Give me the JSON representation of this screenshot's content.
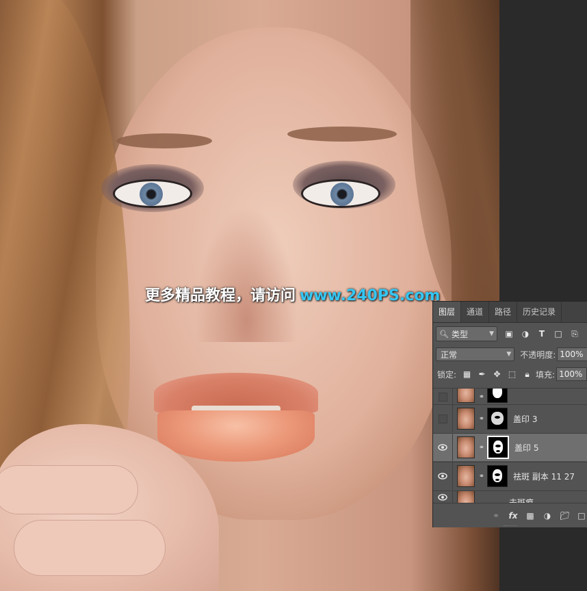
{
  "watermark": {
    "chinese": "更多精品教程，请访问",
    "url": "www.240PS.com"
  },
  "colors": {
    "panel_bg": "#535353",
    "tab_bar_bg": "#424242",
    "selected_layer_bg": "#6f6f6f",
    "watermark_url": "#35c6f2",
    "app_background": "#2b2b2b"
  },
  "panel": {
    "tabs": [
      {
        "label": "图层",
        "active": true
      },
      {
        "label": "通道",
        "active": false
      },
      {
        "label": "路径",
        "active": false
      },
      {
        "label": "历史记录",
        "active": false
      }
    ],
    "filter": {
      "kind_label": "类型",
      "icons": [
        "image-filter-icon",
        "adjustment-filter-icon",
        "type-filter-icon",
        "shape-filter-icon",
        "smart-object-filter-icon"
      ]
    },
    "blend_mode": "正常",
    "opacity_label": "不透明度:",
    "opacity_value": "100%",
    "lock_label": "锁定:",
    "lock_icons": [
      "lock-transparent-pixels-icon",
      "lock-image-pixels-icon",
      "lock-position-icon",
      "lock-artboard-icon",
      "lock-all-icon"
    ],
    "fill_label": "填充:",
    "fill_value": "100%",
    "layers": [
      {
        "name": "盖印 3",
        "visible": false,
        "selected": false
      },
      {
        "name": "盖印 5",
        "visible": true,
        "selected": true
      },
      {
        "name": "祛斑 副本 11 27",
        "visible": true,
        "selected": false
      },
      {
        "name": "去斑痕",
        "visible": true,
        "selected": false
      }
    ],
    "bottom_icons": [
      "link-layers-icon",
      "fx-icon",
      "add-mask-icon",
      "adjustment-layer-icon",
      "new-group-icon",
      "new-layer-icon"
    ],
    "fx_label": "fx"
  }
}
